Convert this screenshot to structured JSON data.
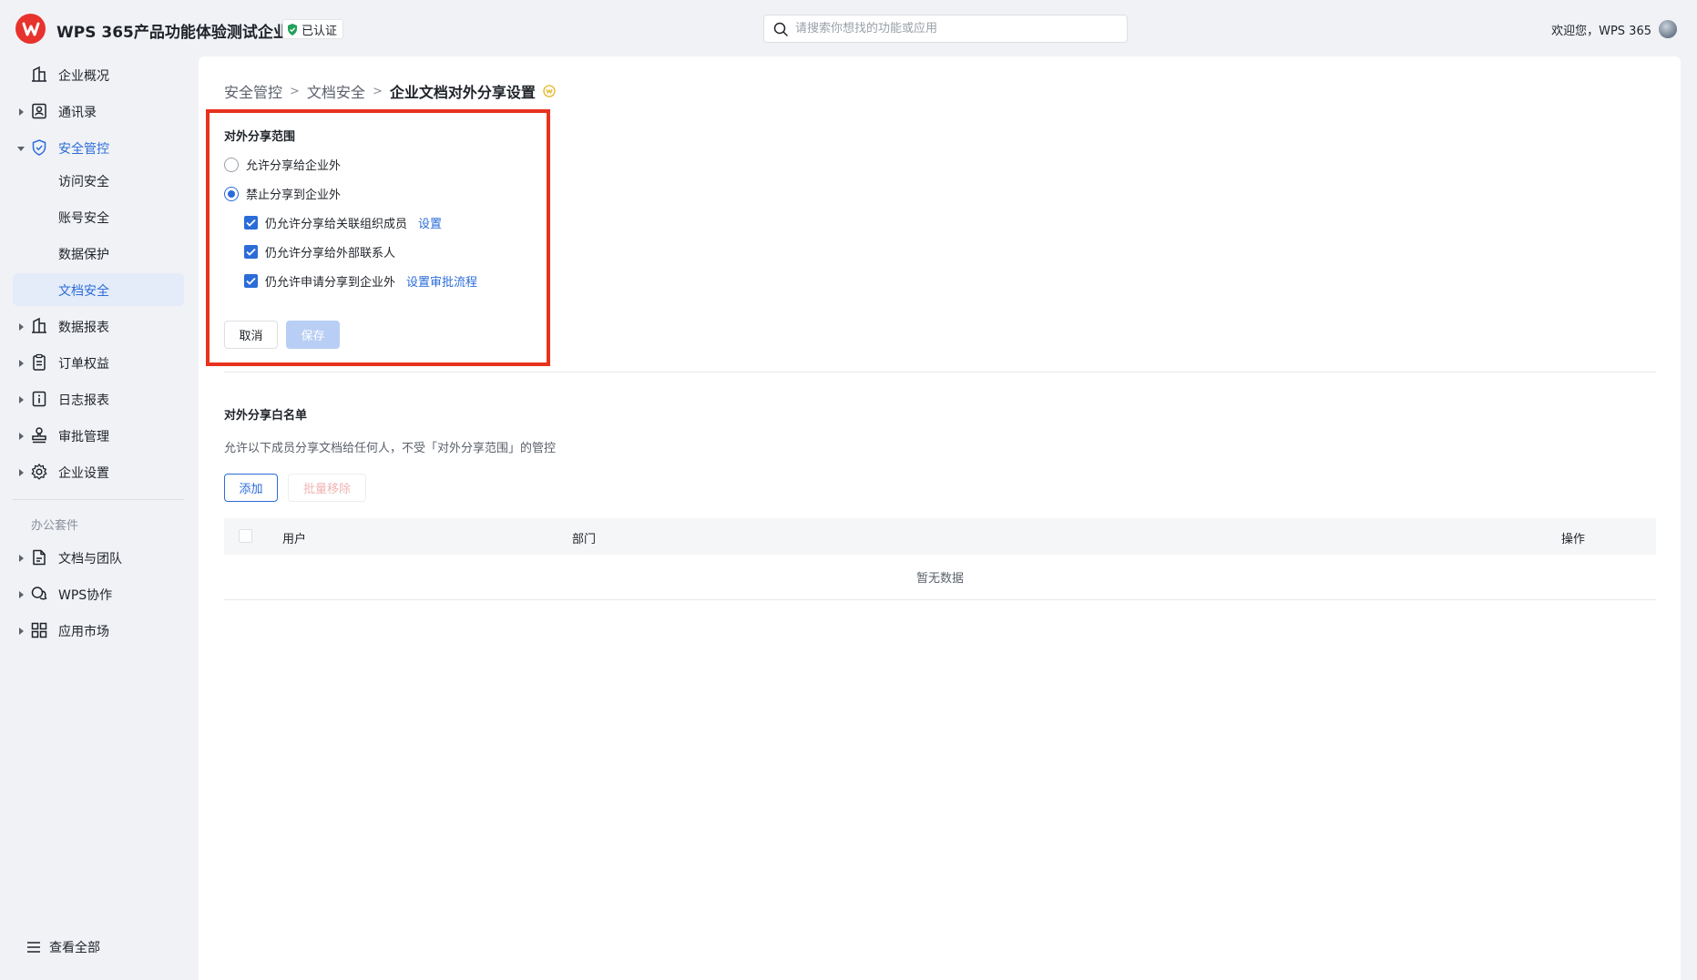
{
  "header": {
    "org_name": "WPS 365产品功能体验测试企业",
    "verified_label": "已认证",
    "search_placeholder": "请搜索你想找的功能或应用",
    "welcome": "欢迎您，WPS 365"
  },
  "sidebar": {
    "items": [
      {
        "label": "企业概况",
        "icon": "building-icon"
      },
      {
        "label": "通讯录",
        "icon": "contacts-icon"
      },
      {
        "label": "安全管控",
        "icon": "shield-icon"
      },
      {
        "label": "访问安全"
      },
      {
        "label": "账号安全"
      },
      {
        "label": "数据保护"
      },
      {
        "label": "文档安全"
      },
      {
        "label": "数据报表",
        "icon": "report-icon"
      },
      {
        "label": "订单权益",
        "icon": "clipboard-icon"
      },
      {
        "label": "日志报表",
        "icon": "info-icon"
      },
      {
        "label": "审批管理",
        "icon": "stamp-icon"
      },
      {
        "label": "企业设置",
        "icon": "gear-icon"
      }
    ],
    "section_label": "办公套件",
    "suite_items": [
      {
        "label": "文档与团队",
        "icon": "document-icon"
      },
      {
        "label": "WPS协作",
        "icon": "chat-icon"
      },
      {
        "label": "应用市场",
        "icon": "grid-icon"
      }
    ],
    "view_all": "查看全部"
  },
  "breadcrumb": {
    "level1": "安全管控",
    "level2": "文档安全",
    "current": "企业文档对外分享设置"
  },
  "share_scope": {
    "title": "对外分享范围",
    "option_allow": "允许分享给企业外",
    "option_forbid": "禁止分享到企业外",
    "check1": "仍允许分享给关联组织成员",
    "check1_link": "设置",
    "check2": "仍允许分享给外部联系人",
    "check3": "仍允许申请分享到企业外",
    "check3_link": "设置审批流程",
    "cancel": "取消",
    "save": "保存"
  },
  "whitelist": {
    "title": "对外分享白名单",
    "description": "允许以下成员分享文档给任何人，不受「对外分享范围」的管控",
    "add": "添加",
    "batch_remove": "批量移除",
    "columns": [
      "用户",
      "部门",
      "操作"
    ],
    "empty": "暂无数据"
  },
  "colors": {
    "accent": "#2b6cd8",
    "highlight": "#e8321e",
    "logo": "#e8322d"
  }
}
